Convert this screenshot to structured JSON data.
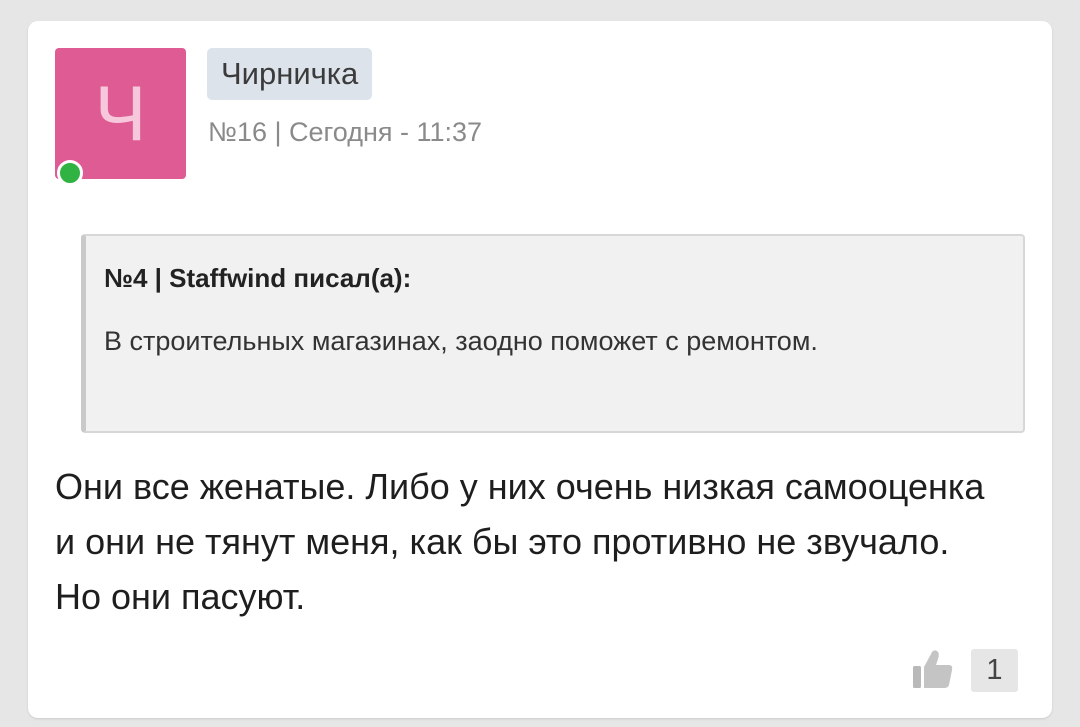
{
  "post": {
    "avatar_letter": "Ч",
    "username": "Чирничка",
    "meta": "№16 | Сегодня - 11:37",
    "online": true,
    "quote": {
      "header": "№4 | Staffwind писал(а):",
      "text": "В строительных магазинах, заодно поможет с ремонтом."
    },
    "body": "Они все женатые. Либо у них очень низкая самооценка и они не тянут меня, как бы это противно не звучало. Но они пасуют.",
    "likes": {
      "icon": "thumbs-up-icon",
      "count": "1"
    }
  },
  "colors": {
    "avatar_bg": "#de5b93",
    "online": "#30b342",
    "username_bg": "#dde3ea"
  }
}
